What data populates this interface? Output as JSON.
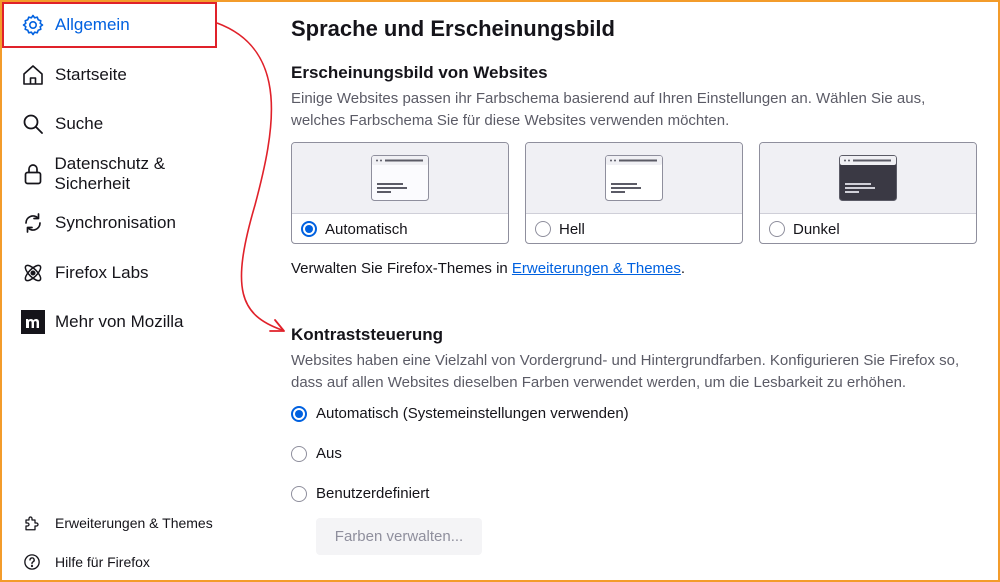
{
  "sidebar": {
    "items": [
      {
        "label": "Allgemein",
        "icon": "gear-icon",
        "selected": true
      },
      {
        "label": "Startseite",
        "icon": "home-icon"
      },
      {
        "label": "Suche",
        "icon": "search-icon"
      },
      {
        "label": "Datenschutz & Sicherheit",
        "icon": "lock-icon"
      },
      {
        "label": "Synchronisation",
        "icon": "sync-icon"
      },
      {
        "label": "Firefox Labs",
        "icon": "atom-icon"
      },
      {
        "label": "Mehr von Mozilla",
        "icon": "mozilla-icon"
      }
    ],
    "footer": [
      {
        "label": "Erweiterungen & Themes",
        "icon": "puzzle-icon"
      },
      {
        "label": "Hilfe für Firefox",
        "icon": "help-icon"
      }
    ]
  },
  "main": {
    "title": "Sprache und Erscheinungsbild",
    "appearance": {
      "heading": "Erscheinungsbild von Websites",
      "description": "Einige Websites passen ihr Farbschema basierend auf Ihren Einstellungen an. Wählen Sie aus, welches Farbschema Sie für diese Websites verwenden möchten.",
      "options": [
        {
          "label": "Automatisch",
          "selected": true
        },
        {
          "label": "Hell",
          "selected": false
        },
        {
          "label": "Dunkel",
          "selected": false
        }
      ],
      "manage_prefix": "Verwalten Sie Firefox-Themes in ",
      "manage_link": "Erweiterungen & Themes",
      "manage_suffix": "."
    },
    "contrast": {
      "heading": "Kontraststeuerung",
      "description": "Websites haben eine Vielzahl von Vordergrund- und Hintergrundfarben. Konfigurieren Sie Firefox so, dass auf allen Websites dieselben Farben verwendet werden, um die Lesbarkeit zu erhöhen.",
      "options": [
        {
          "label": "Automatisch (Systemeinstellungen verwenden)",
          "selected": true
        },
        {
          "label": "Aus",
          "selected": false
        },
        {
          "label": "Benutzerdefiniert",
          "selected": false
        }
      ],
      "manage_colors_button": "Farben verwalten..."
    }
  },
  "colors": {
    "accent": "#0061e0",
    "annotation": "#e0212a",
    "frame": "#f39c2b"
  }
}
